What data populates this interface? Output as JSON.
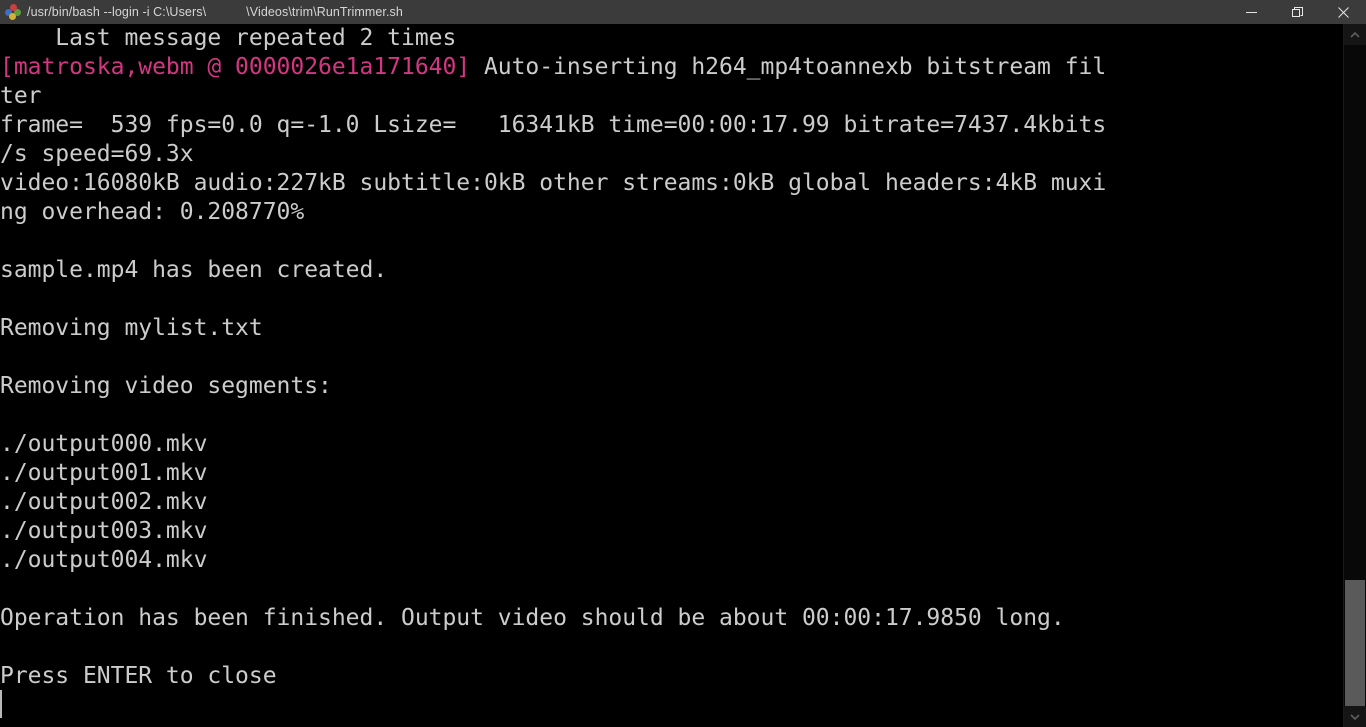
{
  "window": {
    "title_part_1": "/usr/bin/bash --login -i C:\\Users\\",
    "title_part_2": "\\Videos\\trim\\RunTrimmer.sh",
    "icon": "msys2-bash-icon",
    "controls": {
      "minimize_label": "Minimize",
      "restore_label": "Restore",
      "close_label": "Close"
    }
  },
  "colors": {
    "titlebar_background": "#3b3b3b",
    "titlebar_text": "#d6d6d6",
    "terminal_background": "#000000",
    "terminal_foreground": "#cccccc",
    "magenta_text": "#d33682",
    "scrollbar_thumb": "#5a5a5a",
    "cursor": "#b8b8b8"
  },
  "terminal": {
    "prompt_cursor_visible": true,
    "lines": [
      {
        "id": "line-00",
        "color": "default",
        "text": "    Last message repeated 2 times"
      },
      {
        "id": "line-01",
        "color": "magenta",
        "text": "[matroska,webm @ 0000026e1a171640] Auto-inserting h264_mp4toannexb bitstream fil",
        "continuation": "ter",
        "magenta_span": "[matroska,webm @ 0000026e1a171640]",
        "rest": " Auto-inserting h264_mp4toannexb bitstream fil"
      },
      {
        "id": "line-02",
        "color": "default",
        "text": "ter"
      },
      {
        "id": "line-03",
        "color": "default",
        "text": "frame=  539 fps=0.0 q=-1.0 Lsize=   16341kB time=00:00:17.99 bitrate=7437.4kbits"
      },
      {
        "id": "line-04",
        "color": "default",
        "text": "/s speed=69.3x"
      },
      {
        "id": "line-05",
        "color": "default",
        "text": "video:16080kB audio:227kB subtitle:0kB other streams:0kB global headers:4kB muxi"
      },
      {
        "id": "line-06",
        "color": "default",
        "text": "ng overhead: 0.208770%"
      },
      {
        "id": "line-07",
        "color": "default",
        "text": ""
      },
      {
        "id": "line-08",
        "color": "default",
        "text": "sample.mp4 has been created."
      },
      {
        "id": "line-09",
        "color": "default",
        "text": ""
      },
      {
        "id": "line-10",
        "color": "default",
        "text": "Removing mylist.txt"
      },
      {
        "id": "line-11",
        "color": "default",
        "text": ""
      },
      {
        "id": "line-12",
        "color": "default",
        "text": "Removing video segments:"
      },
      {
        "id": "line-13",
        "color": "default",
        "text": ""
      },
      {
        "id": "line-14",
        "color": "default",
        "text": "./output000.mkv"
      },
      {
        "id": "line-15",
        "color": "default",
        "text": "./output001.mkv"
      },
      {
        "id": "line-16",
        "color": "default",
        "text": "./output002.mkv"
      },
      {
        "id": "line-17",
        "color": "default",
        "text": "./output003.mkv"
      },
      {
        "id": "line-18",
        "color": "default",
        "text": "./output004.mkv"
      },
      {
        "id": "line-19",
        "color": "default",
        "text": ""
      },
      {
        "id": "line-20",
        "color": "default",
        "text": "Operation has been finished. Output video should be about 00:00:17.9850 long."
      },
      {
        "id": "line-21",
        "color": "default",
        "text": ""
      },
      {
        "id": "line-22",
        "color": "default",
        "text": "Press ENTER to close"
      }
    ],
    "ffmpeg_stats": {
      "frame": "539",
      "fps": "0.0",
      "q": "-1.0",
      "Lsize": "16341kB",
      "time": "00:00:17.99",
      "bitrate": "7437.4kbits/s",
      "speed": "69.3x",
      "video": "16080kB",
      "audio": "227kB",
      "subtitle": "0kB",
      "other_streams": "0kB",
      "global_headers": "4kB",
      "muxing_overhead": "0.208770%"
    },
    "output_duration": "00:00:17.9850",
    "created_file": "sample.mp4",
    "removed_list_file": "mylist.txt",
    "segments_removed": [
      "./output000.mkv",
      "./output001.mkv",
      "./output002.mkv",
      "./output003.mkv",
      "./output004.mkv"
    ]
  },
  "scrollbar": {
    "up_arrow_label": "Scroll up",
    "down_arrow_label": "Scroll down",
    "thumb_label": "Scroll thumb"
  }
}
